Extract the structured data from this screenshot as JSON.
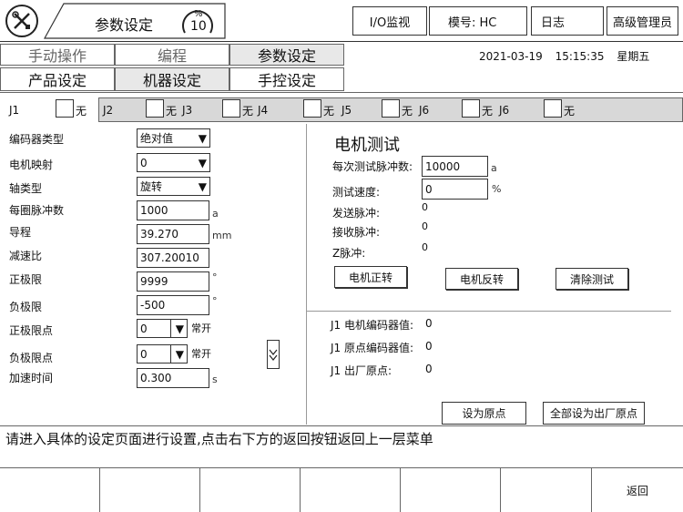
{
  "header": {
    "title": "参数设定",
    "speed": {
      "symbol": "%",
      "value": "10"
    },
    "io_monitor": "I/O监视",
    "model": "模号: HC",
    "log": "日志",
    "user": "高级管理员"
  },
  "tabs_top": [
    {
      "label": "手动操作"
    },
    {
      "label": "编程"
    },
    {
      "label": "参数设定"
    }
  ],
  "datetime": {
    "date": "2021-03-19",
    "time": "15:15:35",
    "weekday": "星期五"
  },
  "tabs_sub": [
    {
      "label": "产品设定"
    },
    {
      "label": "机器设定"
    },
    {
      "label": "手控设定"
    }
  ],
  "joints": [
    {
      "label": "J1",
      "value": "无"
    },
    {
      "label": "J2",
      "value": "无"
    },
    {
      "label": "J3",
      "value": "无"
    },
    {
      "label": "J4",
      "value": "无"
    },
    {
      "label": "J5",
      "value": "无"
    },
    {
      "label": "J6",
      "value": "无"
    },
    {
      "label": "J6",
      "value": "无"
    }
  ],
  "params": {
    "encoder_type": {
      "label": "编码器类型",
      "value": "绝对值"
    },
    "motor_map": {
      "label": "电机映射",
      "value": "0"
    },
    "axis_type": {
      "label": "轴类型",
      "value": "旋转"
    },
    "pulses_per_rev": {
      "label": "每圈脉冲数",
      "value": "1000",
      "unit": "a"
    },
    "lead": {
      "label": "导程",
      "value": "39.270",
      "unit": "mm"
    },
    "reduction": {
      "label": "减速比",
      "value": "307.20010"
    },
    "pos_limit": {
      "label": "正极限",
      "value": "9999",
      "unit": "°"
    },
    "neg_limit": {
      "label": "负极限",
      "value": "-500",
      "unit": "°"
    },
    "pos_limit_point": {
      "label": "正极限点",
      "value": "0",
      "suffix": "常开"
    },
    "neg_limit_point": {
      "label": "负极限点",
      "value": "0",
      "suffix": "常开"
    },
    "accel_time": {
      "label": "加速时间",
      "value": "0.300",
      "unit": "s"
    }
  },
  "motor_test": {
    "title": "电机测试",
    "pulses_label": "每次测试脉冲数:",
    "pulses_value": "10000",
    "pulses_unit": "a",
    "speed_label": "测试速度:",
    "speed_value": "0",
    "speed_unit": "%",
    "sent_label": "发送脉冲:",
    "sent_value": "0",
    "recv_label": "接收脉冲:",
    "recv_value": "0",
    "z_label": "Z脉冲:",
    "z_value": "0",
    "forward_btn": "电机正转",
    "reverse_btn": "电机反转",
    "clear_btn": "清除测试"
  },
  "encoder_info": {
    "motor_enc_label": "J1  电机编码器值:",
    "motor_enc_value": "0",
    "origin_enc_label": "J1  原点编码器值:",
    "origin_enc_value": "0",
    "factory_label": "J1  出厂原点:",
    "factory_value": "0",
    "set_origin_btn": "设为原点",
    "set_all_factory_btn": "全部设为出厂原点"
  },
  "hint": "请进入具体的设定页面进行设置,点击右下方的返回按钮返回上一层菜单",
  "bottom_bar": {
    "back": "返回"
  }
}
